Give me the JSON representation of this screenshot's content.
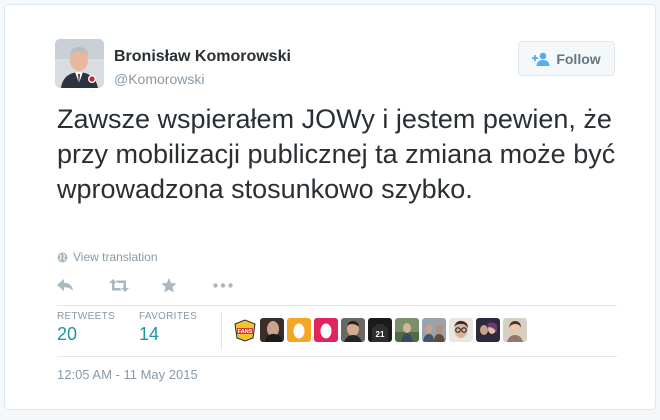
{
  "author": {
    "name": "Bronisław Komorowski",
    "handle": "@Komorowski",
    "avatar_icon": "portrait-avatar"
  },
  "follow_button": {
    "label": "Follow",
    "icon": "add-person-icon"
  },
  "tweet": {
    "text": "Zawsze wspierałem JOWy i jestem pewien, że przy mobilizacji publicznej ta zmiana może być wprowadzona stosunkowo szybko.",
    "translation_link": "View translation",
    "timestamp": "12:05 AM - 11 May 2015"
  },
  "actions": [
    "reply-icon",
    "retweet-icon",
    "favorite-icon",
    "more-icon"
  ],
  "stats": {
    "retweets": {
      "label": "RETWEETS",
      "value": "20"
    },
    "favorites": {
      "label": "FAVORITES",
      "value": "14"
    }
  },
  "colors": {
    "text": "#292f33",
    "muted": "#8899a6",
    "stat_value": "#1b95a8",
    "follow_icon": "#55acee",
    "border": "#e1e8ed"
  },
  "favoriters": [
    {
      "icon": "fans-badge-avatar",
      "badge_text": "FANS"
    },
    {
      "icon": "dark-photo-avatar"
    },
    {
      "icon": "egg-avatar-orange"
    },
    {
      "icon": "egg-avatar-red"
    },
    {
      "icon": "man-portrait-avatar"
    },
    {
      "icon": "jersey-avatar",
      "badge_text": "21"
    },
    {
      "icon": "green-photo-avatar"
    },
    {
      "icon": "group-photo-avatar"
    },
    {
      "icon": "glasses-portrait-avatar"
    },
    {
      "icon": "couple-photo-avatar"
    },
    {
      "icon": "light-photo-avatar"
    }
  ]
}
